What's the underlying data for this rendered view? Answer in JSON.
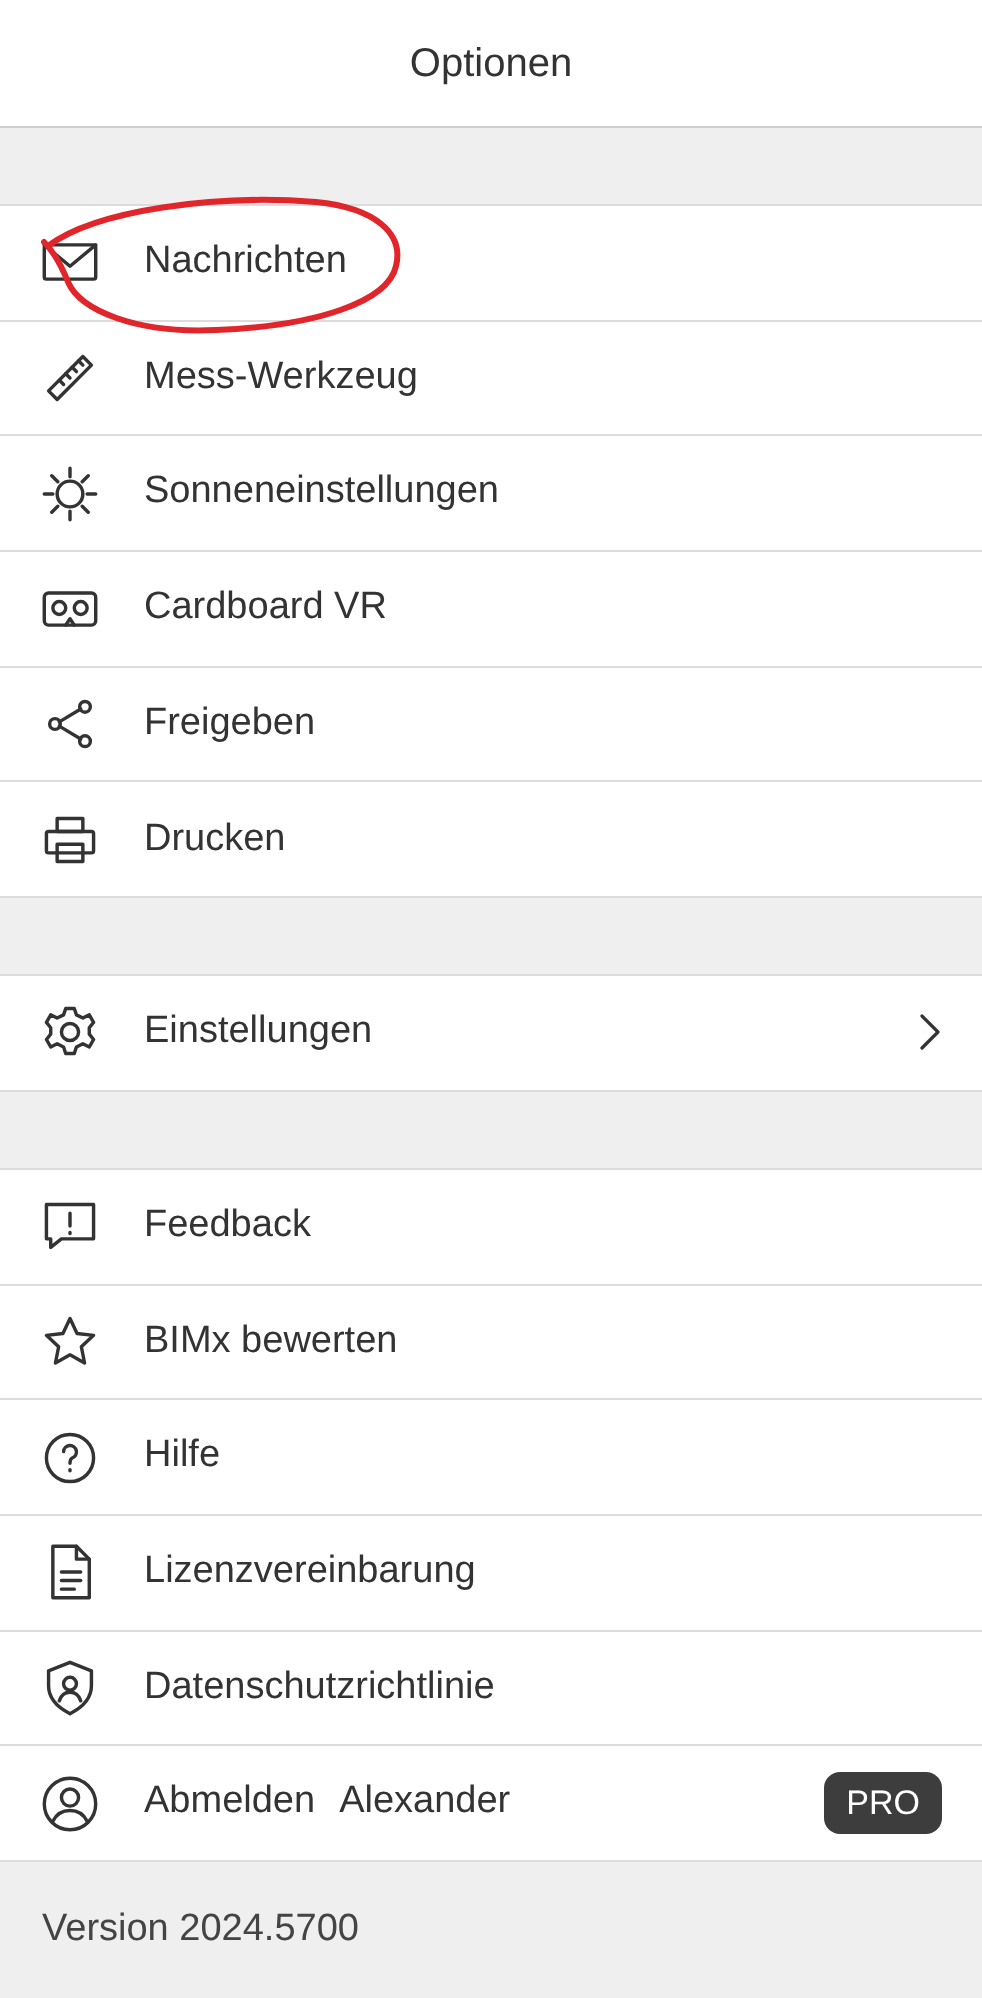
{
  "header": {
    "title": "Optionen"
  },
  "sections": [
    {
      "items": [
        {
          "kind": "action",
          "label": "Nachrichten"
        },
        {
          "kind": "action",
          "label": "Mess-Werkzeug"
        },
        {
          "kind": "action",
          "label": "Sonneneinstellungen"
        },
        {
          "kind": "action",
          "label": "Cardboard VR"
        },
        {
          "kind": "action",
          "label": "Freigeben"
        },
        {
          "kind": "action",
          "label": "Drucken"
        }
      ]
    },
    {
      "items": [
        {
          "kind": "submenu",
          "label": "Einstellungen"
        }
      ]
    },
    {
      "items": [
        {
          "kind": "action",
          "label": "Feedback"
        },
        {
          "kind": "action",
          "label": "BIMx bewerten"
        },
        {
          "kind": "action",
          "label": "Hilfe"
        },
        {
          "kind": "action",
          "label": "Lizenzvereinbarung"
        },
        {
          "kind": "action",
          "label": "Datenschutzrichtlinie"
        },
        {
          "kind": "account",
          "label": "Abmelden",
          "user": "Alexander",
          "badge": "PRO"
        }
      ]
    }
  ],
  "footer": {
    "version": "Version 2024.5700"
  }
}
